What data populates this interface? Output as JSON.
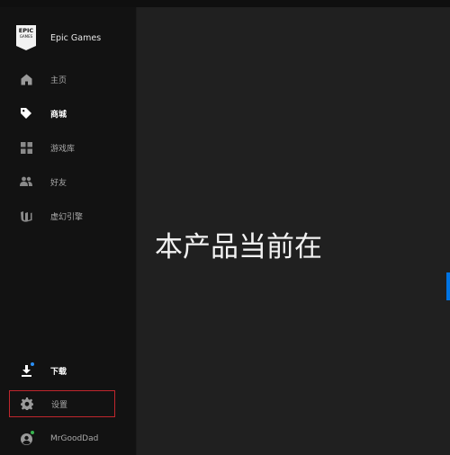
{
  "brand": {
    "logo_line1": "EPIC",
    "logo_line2": "GAMES",
    "name": "Epic Games"
  },
  "sidebar": {
    "items": [
      {
        "label": "主页",
        "icon": "home-icon"
      },
      {
        "label": "商城",
        "icon": "tag-icon"
      },
      {
        "label": "游戏库",
        "icon": "grid-icon"
      },
      {
        "label": "好友",
        "icon": "people-icon"
      },
      {
        "label": "虚幻引擎",
        "icon": "unreal-engine-icon"
      }
    ],
    "bottom": [
      {
        "label": "下载",
        "icon": "download-icon"
      },
      {
        "label": "设置",
        "icon": "gear-icon"
      },
      {
        "label": "MrGoodDad",
        "icon": "user-avatar-icon"
      }
    ]
  },
  "main": {
    "headline": "本产品当前在"
  },
  "colors": {
    "accent": "#0074e4",
    "highlight_border": "#c0262d",
    "sidebar_bg": "#121212",
    "main_bg": "#202020"
  }
}
